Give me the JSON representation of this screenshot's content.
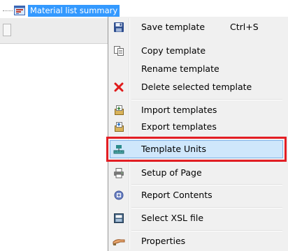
{
  "tree": {
    "node_label": "Material list summary"
  },
  "menu": {
    "save_template": "Save template",
    "save_shortcut": "Ctrl+S",
    "copy_template": "Copy template",
    "rename_template": "Rename template",
    "delete_template": "Delete selected template",
    "import_templates": "Import templates",
    "export_templates": "Export templates",
    "template_units": "Template Units",
    "setup_page": "Setup of Page",
    "report_contents": "Report Contents",
    "select_xsl": "Select XSL file",
    "properties": "Properties",
    "highlighted_item": "Template Units",
    "highlight_color": "#e31e24"
  }
}
